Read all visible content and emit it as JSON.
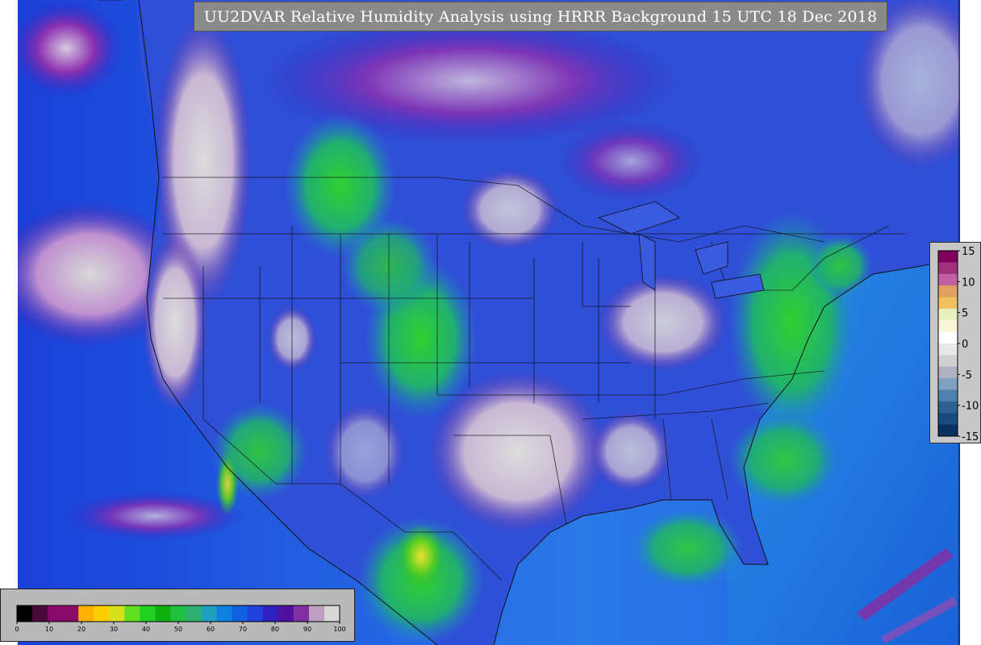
{
  "title": "UU2DVAR Relative Humidity Analysis using HRRR Background 15 UTC 18 Dec 2018",
  "colors": {
    "ocean_deep": "#1a3fd0",
    "ocean_mid": "#2a8ae8",
    "land_blue": "#2f4fd6",
    "moist_green": "#2fd02f",
    "dry_yellow": "#f0e030",
    "saturated_purple": "#7a1aa0",
    "saturated_gray": "#d4d4d4"
  },
  "rh_colorbar": {
    "ticks": [
      "0",
      "10",
      "20",
      "30",
      "40",
      "50",
      "60",
      "70",
      "80",
      "90",
      "100"
    ],
    "colors": [
      "#000000",
      "#4a0a3a",
      "#8a0a6a",
      "#8a0a6a",
      "#ffb000",
      "#ffd000",
      "#d8e020",
      "#60e020",
      "#20d020",
      "#10b010",
      "#20c040",
      "#30b070",
      "#20a0c0",
      "#1080e0",
      "#1060e0",
      "#2040e0",
      "#3020c0",
      "#5010a0",
      "#8030a0",
      "#c0a0c0",
      "#d8d8d8"
    ]
  },
  "increment_colorbar": {
    "ticks": [
      "15",
      "10",
      "5",
      "0",
      "-5",
      "-10",
      "-15"
    ],
    "colors": [
      "#800060",
      "#a0307a",
      "#c060a0",
      "#e0a060",
      "#f0c060",
      "#e8f0c0",
      "#f8f8d8",
      "#ffffff",
      "#e8e8e8",
      "#d0d0d0",
      "#b0b0c0",
      "#80a0c0",
      "#5080b0",
      "#306090",
      "#1a4a80",
      "#0a3060"
    ]
  }
}
